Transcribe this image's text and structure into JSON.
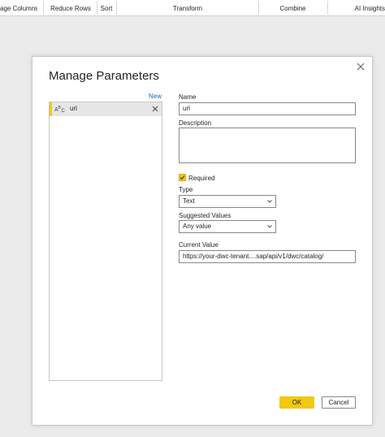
{
  "ribbon": {
    "groups": [
      "age Columns",
      "Reduce Rows",
      "Sort",
      "Transform",
      "Combine",
      "AI Insights"
    ]
  },
  "dialog": {
    "title": "Manage Parameters",
    "new_link": "New",
    "parameters": [
      {
        "type_glyph": "A B C",
        "name": "url"
      }
    ],
    "name_label": "Name",
    "name_value": "url",
    "description_label": "Description",
    "description_value": "",
    "required_label": "Required",
    "required_checked": true,
    "type_label": "Type",
    "type_value": "Text",
    "suggested_label": "Suggested Values",
    "suggested_value": "Any value",
    "current_label": "Current Value",
    "current_value": "https://your-dwc-tenant....sap/api/v1/dwc/catalog/",
    "ok_label": "OK",
    "cancel_label": "Cancel"
  },
  "colors": {
    "accent_yellow": "#f2c811",
    "link_blue": "#0f6cbd",
    "backdrop": "#ebebeb"
  },
  "icons": [
    "close-icon",
    "text-type-icon",
    "delete-parameter-icon",
    "chevron-down-icon",
    "checkmark-icon"
  ]
}
